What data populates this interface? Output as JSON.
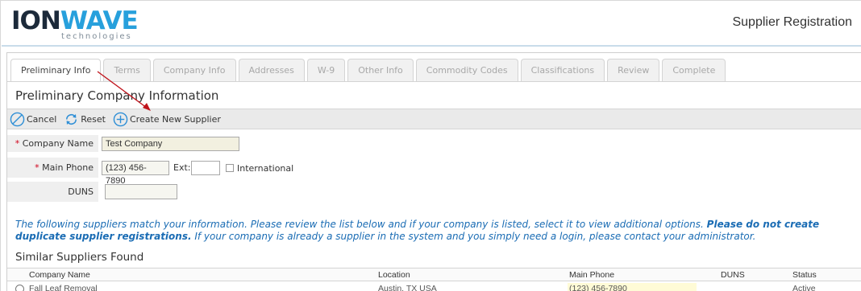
{
  "header": {
    "logo_main": "ION",
    "logo_accent": "WAVE",
    "logo_sub": "technologies",
    "page_title": "Supplier Registration"
  },
  "tabs": [
    {
      "label": "Preliminary Info",
      "active": true
    },
    {
      "label": "Terms",
      "active": false
    },
    {
      "label": "Company Info",
      "active": false
    },
    {
      "label": "Addresses",
      "active": false
    },
    {
      "label": "W-9",
      "active": false
    },
    {
      "label": "Other Info",
      "active": false
    },
    {
      "label": "Commodity Codes",
      "active": false
    },
    {
      "label": "Classifications",
      "active": false
    },
    {
      "label": "Review",
      "active": false
    },
    {
      "label": "Complete",
      "active": false
    }
  ],
  "section_title": "Preliminary Company Information",
  "toolbar": {
    "cancel_label": "Cancel",
    "reset_label": "Reset",
    "create_label": "Create New Supplier"
  },
  "form": {
    "company_name_label": "Company Name",
    "company_name_value": "Test Company",
    "main_phone_label": "Main Phone",
    "main_phone_value": "(123) 456-7890",
    "ext_label": "Ext:",
    "ext_value": "",
    "international_label": "International",
    "duns_label": "DUNS",
    "duns_value": "",
    "required_marker": "*"
  },
  "info": {
    "text_1": "The following suppliers match your information. Please review the list below and if your company is listed, select it to view additional options. ",
    "text_bold": "Please do not create duplicate supplier registrations.",
    "text_2": " If your company is already a supplier in the system and you simply need a login, please contact your administrator."
  },
  "similar": {
    "title": "Similar Suppliers Found",
    "columns": [
      "Company Name",
      "Location",
      "Main Phone",
      "DUNS",
      "Status"
    ],
    "rows": [
      {
        "company": "Fall Leaf Removal",
        "location": "Austin, TX USA",
        "phone": "(123) 456-7890",
        "duns": "",
        "status": "Active"
      }
    ]
  },
  "colors": {
    "brand_dark": "#1c2a3a",
    "brand_blue": "#27a0dc",
    "info_text": "#1a6cb4",
    "icon_blue": "#2f8fd6",
    "annotation_red": "#c0141c",
    "required": "#d0021b"
  },
  "icons": {
    "cancel": "cancel-circle-icon",
    "reset": "reset-arrows-icon",
    "create": "plus-circle-icon"
  }
}
